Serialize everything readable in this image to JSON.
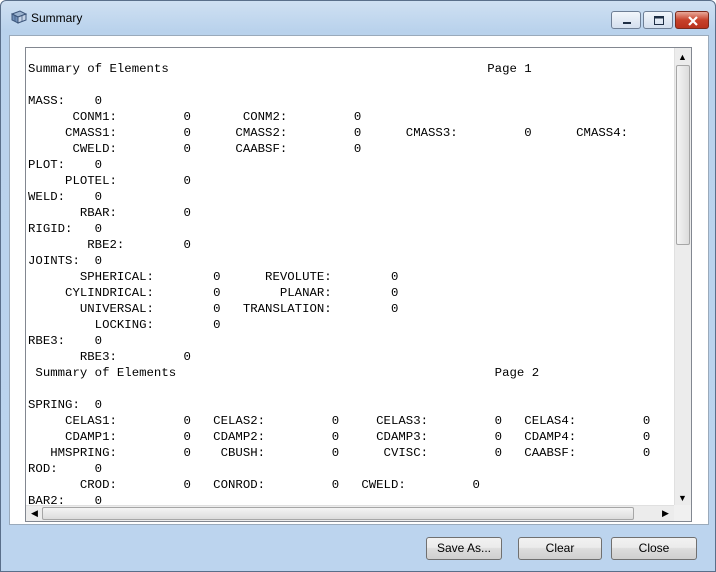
{
  "window": {
    "title": "Summary",
    "app_icon": "grid-icon",
    "controls": [
      "minimize-icon",
      "maximize-icon",
      "close-icon"
    ]
  },
  "report": {
    "text": "Summary of Elements                                           Page 1\n\nMASS:    0\n      CONM1:         0       CONM2:         0\n     CMASS1:         0      CMASS2:         0      CMASS3:         0      CMASS4:\n      CWELD:         0      CAABSF:         0\nPLOT:    0\n     PLOTEL:         0\nWELD:    0\n       RBAR:         0\nRIGID:   0\n        RBE2:        0\nJOINTS:  0\n       SPHERICAL:        0      REVOLUTE:        0\n     CYLINDRICAL:        0        PLANAR:        0\n       UNIVERSAL:        0   TRANSLATION:        0\n         LOCKING:        0\nRBE3:    0\n       RBE3:         0\n Summary of Elements                                           Page 2\n\nSPRING:  0\n     CELAS1:         0   CELAS2:         0     CELAS3:         0   CELAS4:         0\n     CDAMP1:         0   CDAMP2:         0     CDAMP3:         0   CDAMP4:         0\n   HMSPRING:         0    CBUSH:         0      CVISC:         0   CAABSF:         0\nROD:     0\n       CROD:         0   CONROD:         0   CWELD:         0\nBAR2:    0"
  },
  "buttons": {
    "save_as": "Save As...",
    "clear": "Clear",
    "close": "Close"
  }
}
